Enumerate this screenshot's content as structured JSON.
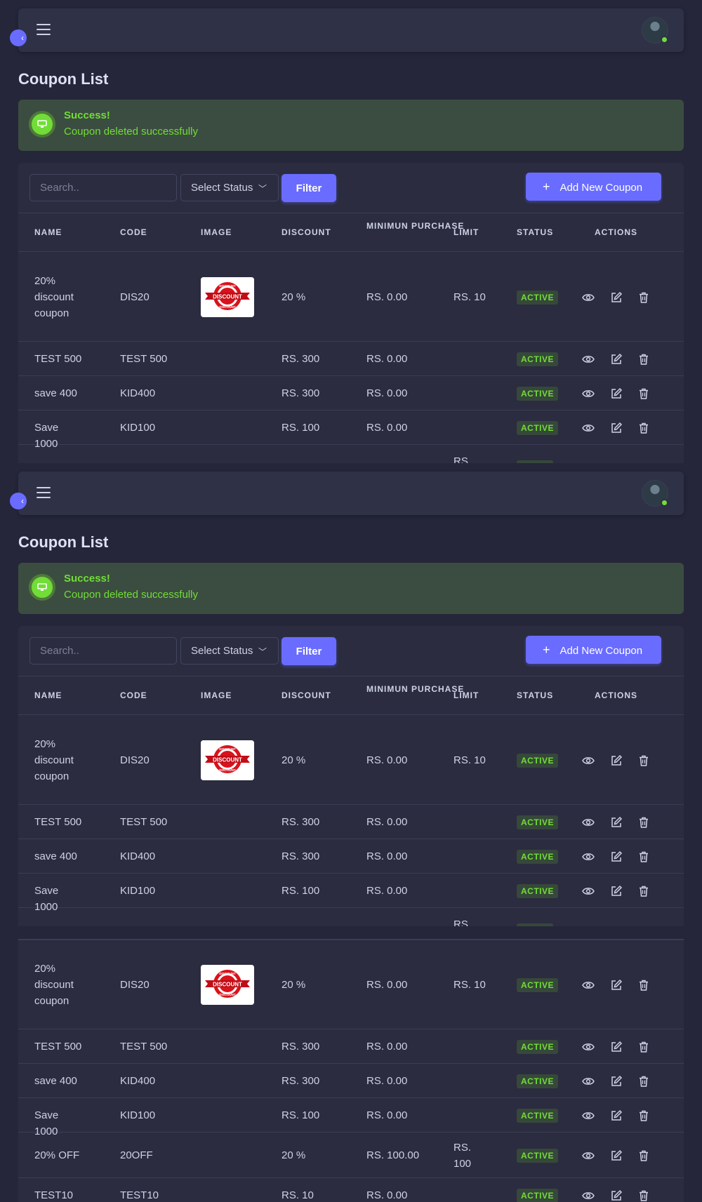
{
  "colors": {
    "background": "#25263a",
    "card": "#2b2c40",
    "primary": "#696cff",
    "success": "#71dd37"
  },
  "navbar": {
    "menu_icon": "menu-icon",
    "avatar_icon": "avatar"
  },
  "page": {
    "title": "Coupon List"
  },
  "alert": {
    "title": "Success!",
    "message": "Coupon deleted successfully",
    "icon": "monitor-icon"
  },
  "toolbar": {
    "search_placeholder": "Search..",
    "status_select": "Select Status",
    "filter_label": "Filter",
    "add_label": "Add New Coupon"
  },
  "table": {
    "headers": [
      "NAME",
      "CODE",
      "IMAGE",
      "DISCOUNT",
      "MINIMUN PURCHASE",
      "LIMIT",
      "STATUS",
      "ACTIONS"
    ],
    "image_text": {
      "top": "DISCOUNT",
      "banner": "DISCOUNT",
      "bottom": "DISCOUNT"
    },
    "rows": [
      {
        "name": "20% discount coupon",
        "code": "DIS20",
        "discount": "20 %",
        "min_purchase": "RS. 0.00",
        "limit": "RS. 10",
        "status": "ACTIVE"
      },
      {
        "name": "TEST 500",
        "code": "TEST 500",
        "discount": "RS. 300",
        "min_purchase": "RS. 0.00",
        "limit": "",
        "status": "ACTIVE"
      },
      {
        "name": "save 400",
        "code": "KID400",
        "discount": "RS. 300",
        "min_purchase": "RS. 0.00",
        "limit": "",
        "status": "ACTIVE"
      },
      {
        "name": "Save 1000",
        "code": "KID100",
        "discount": "RS. 100",
        "min_purchase": "RS. 0.00",
        "limit": "",
        "status": "ACTIVE"
      },
      {
        "name": "20% OFF",
        "code": "20OFF",
        "discount": "20 %",
        "min_purchase": "RS. 100.00",
        "limit": "RS. 100",
        "status": "ACTIVE"
      },
      {
        "name": "TEST10",
        "code": "TEST10",
        "discount": "RS. 10",
        "min_purchase": "RS. 0.00",
        "limit": "",
        "status": "ACTIVE"
      }
    ],
    "partial_limit": "RS."
  }
}
